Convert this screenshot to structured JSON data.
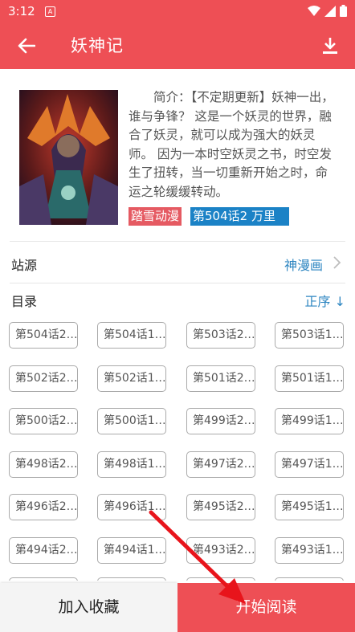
{
  "status": {
    "time": "3:12",
    "app_badge": "A"
  },
  "toolbar": {
    "title": "妖神记"
  },
  "intro": {
    "text": "简介：【不定期更新】妖神一出，谁与争锋？ 这是一个妖灵的世界，融合了妖灵，就可以成为强大的妖灵师。 因为一本时空妖灵之书，时空发生了扭转，当一切重新开始之时，命运之轮缓缓转动。"
  },
  "tags": {
    "author": "踏雪动漫",
    "latest": "第504话2 万里"
  },
  "source": {
    "label": "站源",
    "value": "神漫画"
  },
  "catalog": {
    "label": "目录",
    "order": "正序 ↓"
  },
  "chapters": [
    "第504话2…",
    "第504话1…",
    "第503话2…",
    "第503话1…",
    "第502话2…",
    "第502话1…",
    "第501话2…",
    "第501话1…",
    "第500话2…",
    "第500话1…",
    "第499话2…",
    "第499话1…",
    "第498话2…",
    "第498话1…",
    "第497话2…",
    "第497话1…",
    "第496话2…",
    "第496话1…",
    "第495话2…",
    "第495话1…",
    "第494话2…",
    "第494话1…",
    "第493话2…",
    "第493话1…",
    "",
    "",
    "",
    ""
  ],
  "actions": {
    "favorite": "加入收藏",
    "start_reading": "开始阅读"
  },
  "colors": {
    "primary": "#ee4f55",
    "link": "#2e86c1",
    "author_tag": "#e55a62",
    "latest_tag": "#1b82c6"
  }
}
